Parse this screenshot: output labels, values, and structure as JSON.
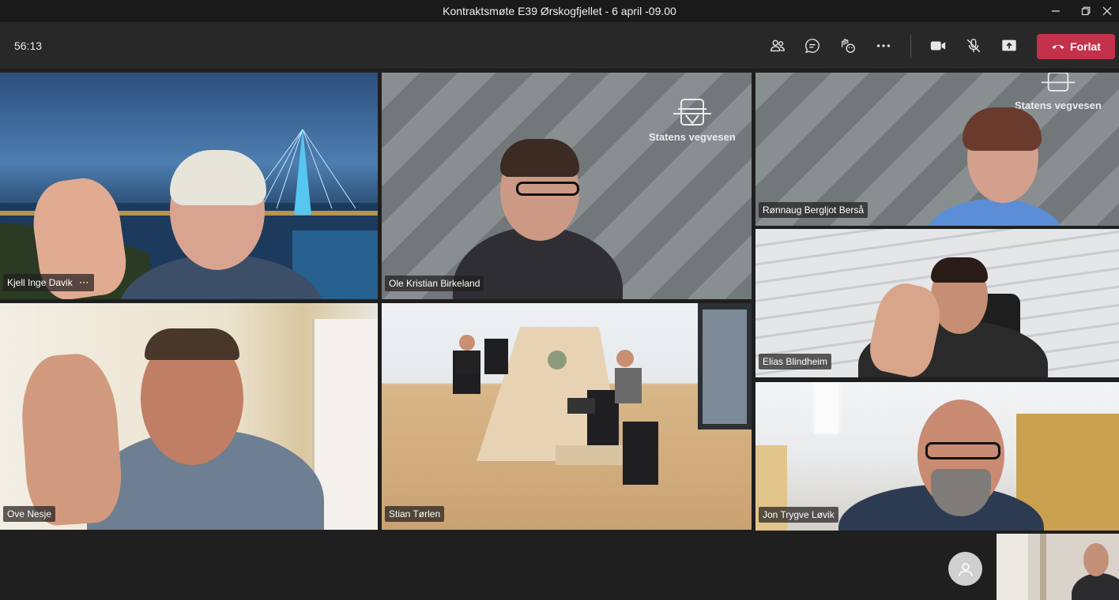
{
  "window": {
    "title": "Kontraktsmøte E39 Ørskogfjellet - 6 april -09.00"
  },
  "toolbar": {
    "timer": "56:13",
    "leave_label": "Forlat"
  },
  "icons": {
    "participants": "people-icon",
    "chat": "chat-icon",
    "reactions": "raise-hand-icon",
    "more": "more-icon",
    "camera": "video-camera-icon",
    "mic": "mic-off-icon",
    "share": "share-screen-icon",
    "leave": "phone-hangup-icon"
  },
  "colors": {
    "leave_button": "#c4314b",
    "toolbar_bg": "#292828",
    "stage_bg": "#201f1f"
  },
  "participants": [
    {
      "name": "Kjell Inge Davik",
      "has_menu": true,
      "menu_glyph": "⋯"
    },
    {
      "name": "Ole Kristian Birkeland"
    },
    {
      "name": "Rønnaug Bergljot Berså"
    },
    {
      "name": "Elias Blindheim"
    },
    {
      "name": "Ove Nesje"
    },
    {
      "name": "Stian Tørlen"
    },
    {
      "name": "Jon Trygve Løvik"
    }
  ],
  "branding": {
    "background_text": "Statens vegvesen"
  }
}
